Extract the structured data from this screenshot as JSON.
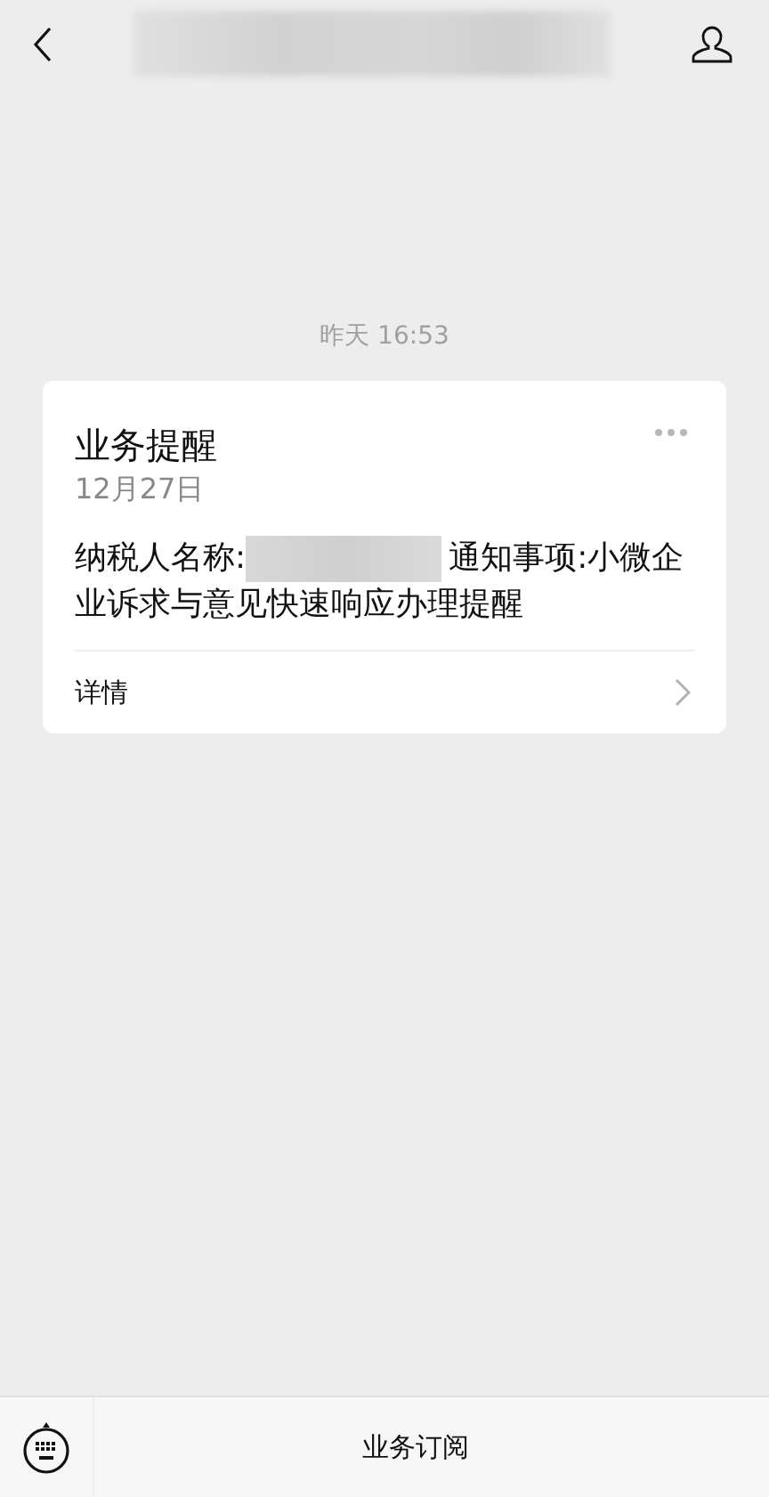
{
  "header": {
    "title": {
      "kind": "redacted"
    }
  },
  "messages": [
    {
      "time": "昨天 16:53",
      "card": {
        "title": "业务提醒",
        "date": "12月27日",
        "body_prefix": "纳税人名称:",
        "body_redacted": true,
        "body_lines": [
          "通知事项:小微企",
          "业诉求与意见快速响应办理提醒"
        ],
        "link": "详情"
      }
    }
  ],
  "bottom_bar": {
    "menu": "业务订阅"
  }
}
